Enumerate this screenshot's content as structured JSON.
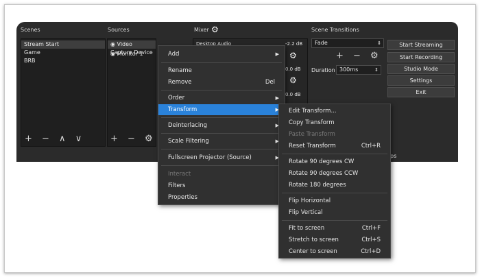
{
  "panels": {
    "scenes_label": "Scenes",
    "sources_label": "Sources",
    "mixer_label": "Mixer",
    "transitions_label": "Scene Transitions"
  },
  "scenes": [
    "Stream Start",
    "Game",
    "BRB"
  ],
  "sources": [
    "Video Capture Device",
    "Monitor 1"
  ],
  "scene_toolbar": "+ − ∧ ∨",
  "source_toolbar": "+ − ⚙",
  "mixer": {
    "desktop_audio": "Desktop Audio",
    "db_values": [
      "-2.2 dB",
      "0.0 dB",
      "0.0 dB"
    ]
  },
  "transitions": {
    "selected": "Fade",
    "duration_label": "Duration",
    "duration_value": "300ms",
    "toolbar": "+ − ⚙"
  },
  "controls": [
    "Start Streaming",
    "Start Recording",
    "Studio Mode",
    "Settings",
    "Exit"
  ],
  "context_menu": {
    "add": "Add",
    "rename": "Rename",
    "remove": "Remove",
    "remove_shortcut": "Del",
    "order": "Order",
    "transform": "Transform",
    "deinterlacing": "Deinterlacing",
    "scale_filtering": "Scale Filtering",
    "fullscreen_projector": "Fullscreen Projector (Source)",
    "interact": "Interact",
    "filters": "Filters",
    "properties": "Properties"
  },
  "transform_menu": {
    "edit": "Edit Transform...",
    "copy": "Copy Transform",
    "paste": "Paste Transform",
    "reset": "Reset Transform",
    "reset_shortcut": "Ctrl+R",
    "rot_cw": "Rotate 90 degrees CW",
    "rot_ccw": "Rotate 90 degrees CCW",
    "rot_180": "Rotate 180 degrees",
    "flip_h": "Flip Horizontal",
    "flip_v": "Flip Vertical",
    "fit": "Fit to screen",
    "fit_shortcut": "Ctrl+F",
    "stretch": "Stretch to screen",
    "stretch_shortcut": "Ctrl+S",
    "center": "Center to screen",
    "center_shortcut": "Ctrl+D"
  },
  "status_fragment": "ps",
  "colors": {
    "highlight": "#2a82da",
    "panel_bg": "#2b2b2b",
    "menu_bg": "#303030"
  }
}
